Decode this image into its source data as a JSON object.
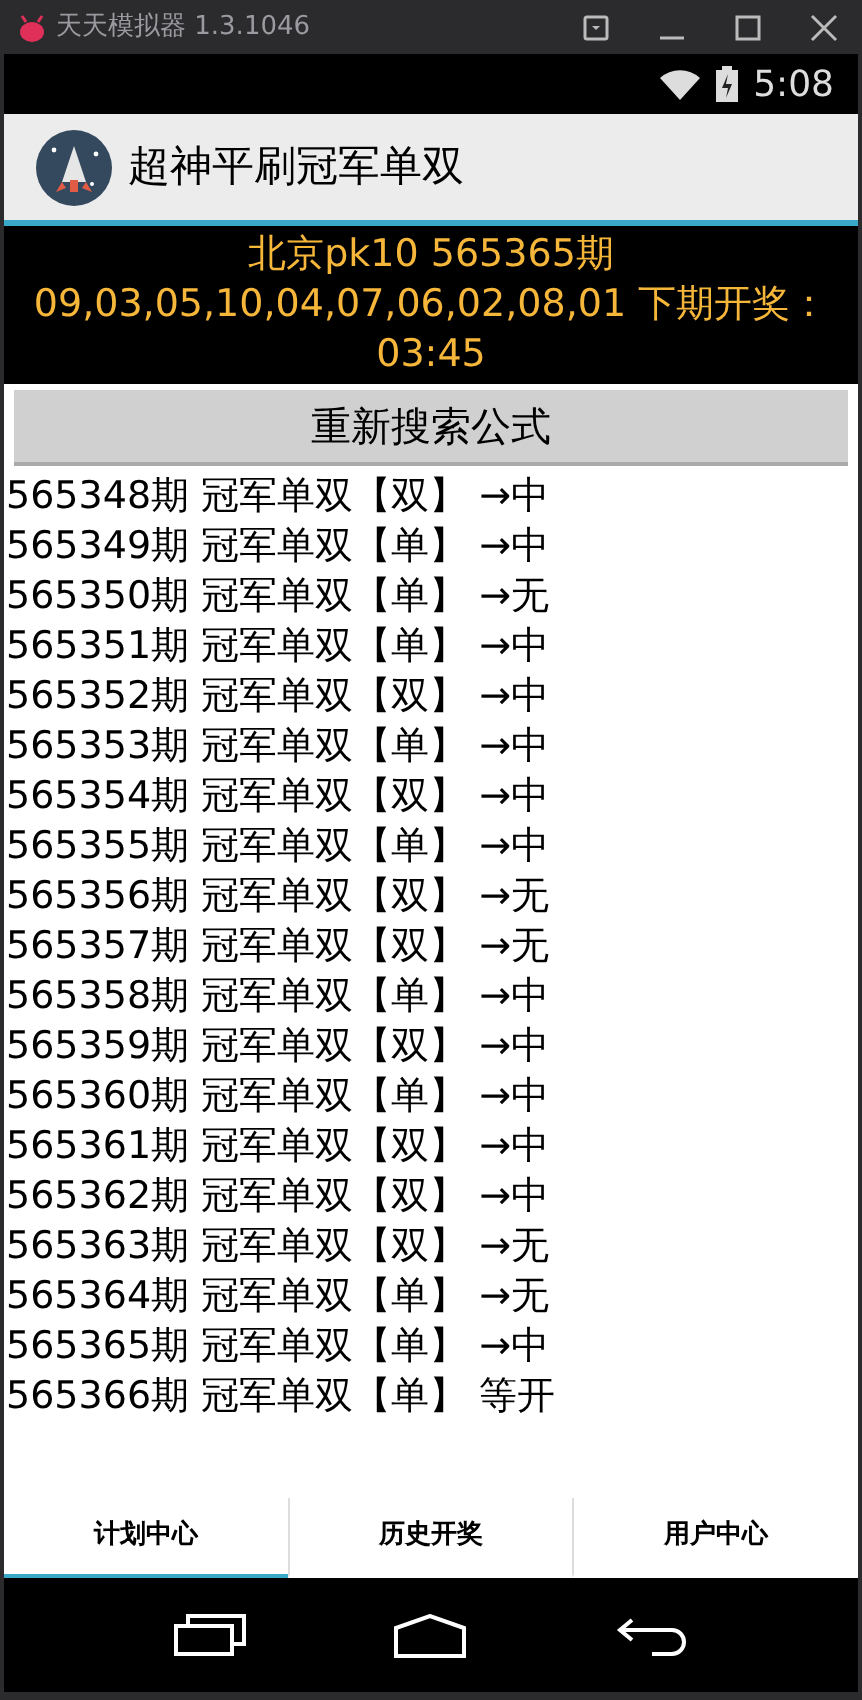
{
  "emulator": {
    "title": "天天模拟器 1.3.1046"
  },
  "status_bar": {
    "time": "5:08"
  },
  "app_bar": {
    "title": "超神平刷冠军单双"
  },
  "draw_info": {
    "line_1": "北京pk10 565365期",
    "line_2": "09,03,05,10,04,07,06,02,08,01 下期开奖：03:45"
  },
  "search_button": {
    "label": "重新搜索公式"
  },
  "rows": [
    "565348期 冠军单双【双】 →中",
    "565349期 冠军单双【单】 →中",
    "565350期 冠军单双【单】 →无",
    "565351期 冠军单双【单】 →中",
    "565352期 冠军单双【双】 →中",
    "565353期 冠军单双【单】 →中",
    "565354期 冠军单双【双】 →中",
    "565355期 冠军单双【单】 →中",
    "565356期 冠军单双【双】 →无",
    "565357期 冠军单双【双】 →无",
    "565358期 冠军单双【单】 →中",
    "565359期 冠军单双【双】 →中",
    "565360期 冠军单双【单】 →中",
    "565361期 冠军单双【双】 →中",
    "565362期 冠军单双【双】 →中",
    "565363期 冠军单双【双】 →无",
    "565364期 冠军单双【单】 →无",
    "565365期 冠军单双【单】 →中",
    "565366期 冠军单双【单】 等开"
  ],
  "tabs": [
    {
      "label": "计划中心",
      "selected": true
    },
    {
      "label": "历史开奖",
      "selected": false
    },
    {
      "label": "用户中心",
      "selected": false
    }
  ]
}
